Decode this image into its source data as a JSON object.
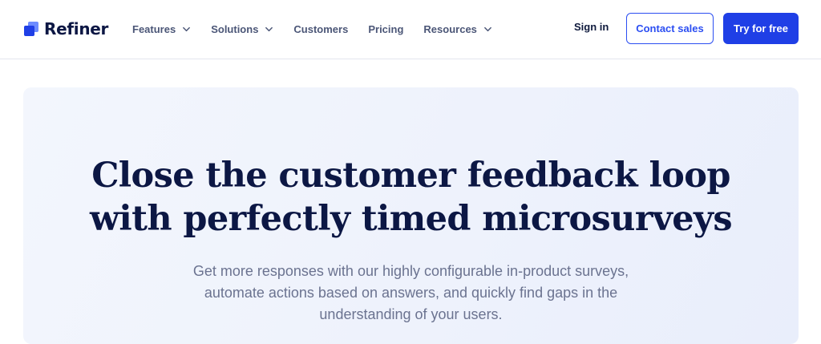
{
  "brand": {
    "name": "Refiner"
  },
  "nav": {
    "items": [
      {
        "label": "Features",
        "has_dropdown": true
      },
      {
        "label": "Solutions",
        "has_dropdown": true
      },
      {
        "label": "Customers",
        "has_dropdown": false
      },
      {
        "label": "Pricing",
        "has_dropdown": false
      },
      {
        "label": "Resources",
        "has_dropdown": true
      }
    ],
    "signin_label": "Sign in",
    "contact_label": "Contact sales",
    "try_label": "Try for free"
  },
  "hero": {
    "title_line1": "Close the customer feedback loop",
    "title_line2": "with perfectly timed microsurveys",
    "subtitle_line1": "Get more responses with our highly configurable in-product surveys,",
    "subtitle_line2": "automate actions based on answers, and quickly find gaps in the",
    "subtitle_line3": "understanding of your users."
  },
  "colors": {
    "brand_blue": "#1f3fe6",
    "heading_navy": "#0c1744",
    "hero_bg": "#eef2fc"
  }
}
